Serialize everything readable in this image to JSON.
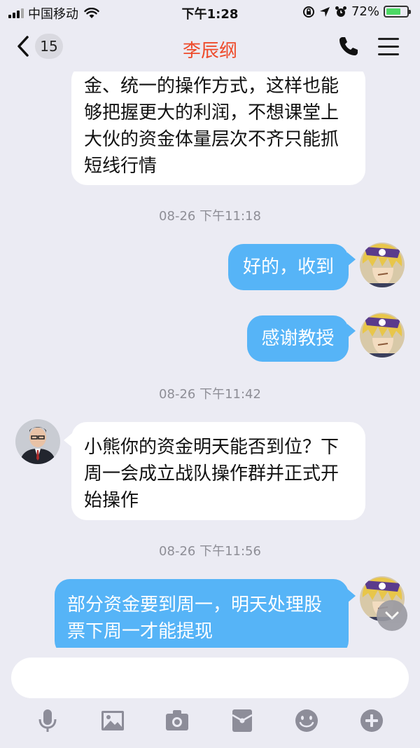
{
  "status_bar": {
    "carrier": "中国移动",
    "time": "下午1:28",
    "battery_percent": "72%"
  },
  "header": {
    "unread_count": "15",
    "title": "李辰纲"
  },
  "messages": [
    {
      "side": "in",
      "lines": [
        "金、统一的操作方式，这样也能",
        "够把握更大的利润，不想课堂上",
        "大伙的资金体量层次不齐只能抓",
        "短线行情"
      ]
    },
    {
      "timestamp": "08-26 下午11:18"
    },
    {
      "side": "out",
      "text": "好的，收到"
    },
    {
      "side": "out",
      "text": "感谢教授"
    },
    {
      "timestamp": "08-26 下午11:42"
    },
    {
      "side": "in",
      "lines": [
        "小熊你的资金明天能否到位？下",
        "周一会成立战队操作群并正式开",
        "始操作"
      ]
    },
    {
      "timestamp": "08-26 下午11:56"
    },
    {
      "side": "out",
      "lines": [
        "部分资金要到周一，明天处理股",
        "票下周一才能提现"
      ]
    }
  ],
  "input": {
    "placeholder": ""
  },
  "toolbar": {
    "icons": [
      "microphone-icon",
      "image-icon",
      "camera-icon",
      "red-packet-icon",
      "emoji-icon",
      "plus-icon"
    ]
  },
  "colors": {
    "accent_title": "#ee4b2b",
    "outgoing_bubble": "#56b4f7",
    "incoming_bubble": "#ffffff",
    "background": "#ebebf3",
    "toolbar_icon": "#8d8d99"
  }
}
